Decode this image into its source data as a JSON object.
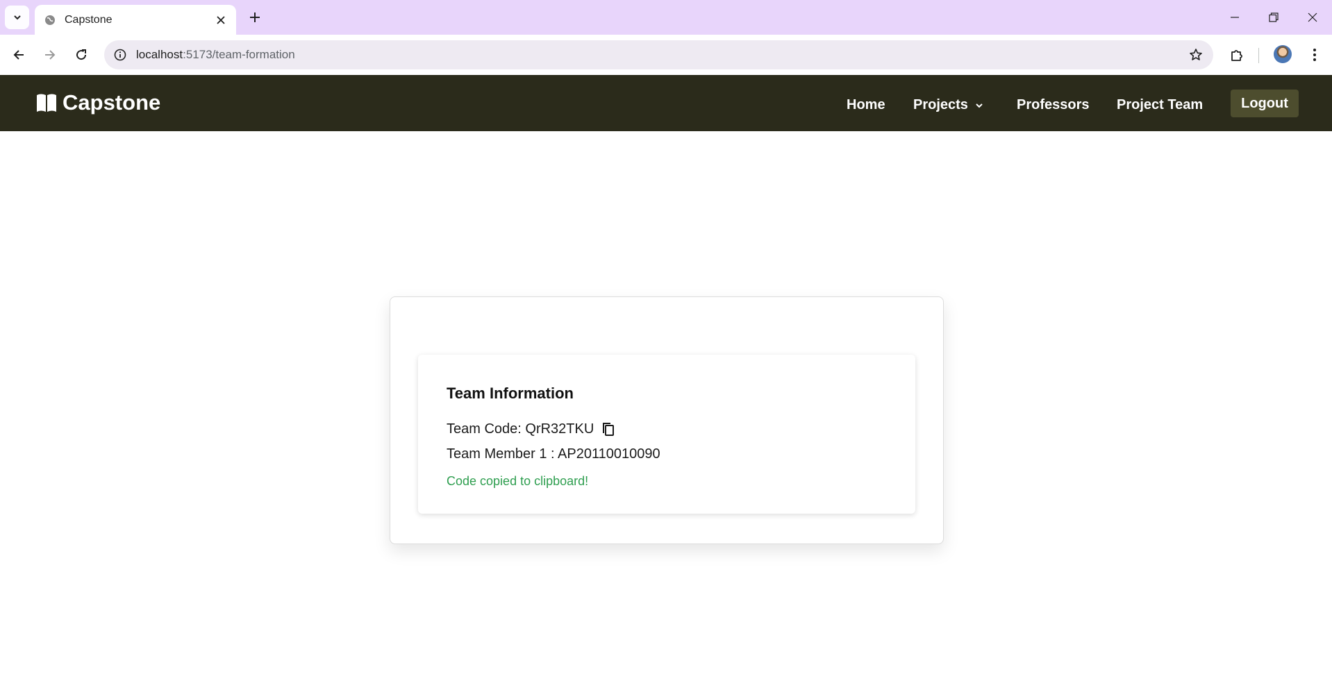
{
  "browser": {
    "tab_title": "Capstone",
    "url_host": "localhost",
    "url_path": ":5173/team-formation"
  },
  "app": {
    "brand": "Capstone",
    "nav": {
      "home": "Home",
      "projects": "Projects",
      "professors": "Professors",
      "project_team": "Project Team",
      "logout": "Logout"
    }
  },
  "team_info": {
    "title": "Team Information",
    "code_label": "Team Code: QrR32TKU",
    "member_label": "Team Member 1 : AP20110010090",
    "status_message": "Code copied to clipboard!"
  },
  "colors": {
    "navbar_bg": "#2b2b1b",
    "logout_bg": "#4d4d2e",
    "success_text": "#2e9e4f",
    "tabstrip_bg": "#e8d5fb"
  },
  "icons": [
    "tab-search-icon",
    "globe-icon",
    "close-icon",
    "plus-icon",
    "minimize-icon",
    "restore-icon",
    "window-close-icon",
    "back-icon",
    "forward-icon",
    "reload-icon",
    "info-icon",
    "star-icon",
    "extensions-icon",
    "more-icon",
    "book-icon",
    "chevron-down-icon",
    "copy-icon"
  ]
}
